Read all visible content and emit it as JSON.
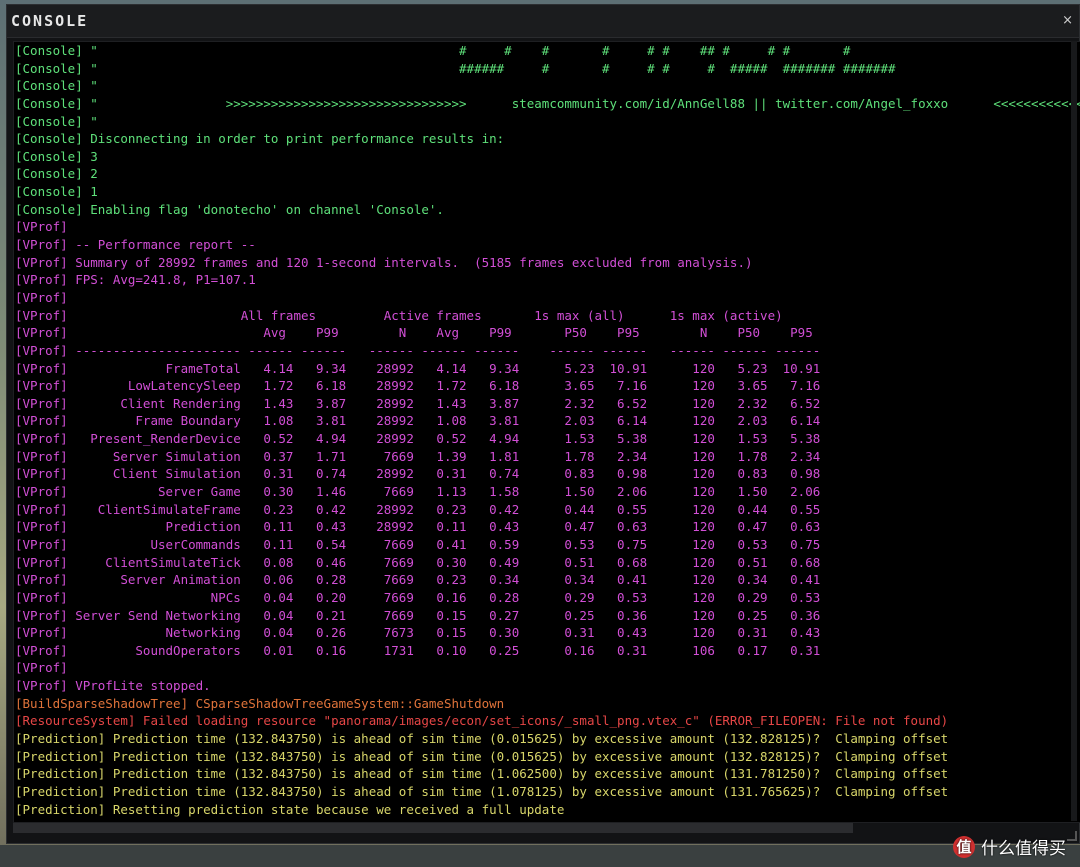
{
  "window": {
    "title": "CONSOLE",
    "close_glyph": "×"
  },
  "log_lines": [
    {
      "t": "console",
      "text": "[Console] \"                                                #     #    #       #     # #    ## #     # #       #"
    },
    {
      "t": "console",
      "text": "[Console] \"                                                ######     #       #     # #     #  #####  ####### #######"
    },
    {
      "t": "console",
      "text": "[Console] \""
    },
    {
      "t": "console",
      "text": "[Console] \"                 >>>>>>>>>>>>>>>>>>>>>>>>>>>>>>>>      steamcommunity.com/id/AnnGell88 || twitter.com/Angel_foxxo      <<<<<<<<<<<<<<<<<<<<<<<<<<<<<<<<"
    },
    {
      "t": "console",
      "text": "[Console] \""
    },
    {
      "t": "console",
      "text": "[Console] Disconnecting in order to print performance results in:"
    },
    {
      "t": "console",
      "text": "[Console] 3"
    },
    {
      "t": "console",
      "text": "[Console] 2"
    },
    {
      "t": "console",
      "text": "[Console] 1"
    },
    {
      "t": "console",
      "text": "[Console] Enabling flag 'donotecho' on channel 'Console'."
    },
    {
      "t": "vprof",
      "text": "[VProf]"
    },
    {
      "t": "vprof",
      "text": "[VProf] -- Performance report --"
    },
    {
      "t": "vprof",
      "text": "[VProf] Summary of 28992 frames and 120 1-second intervals.  (5185 frames excluded from analysis.)"
    },
    {
      "t": "vprof",
      "text": "[VProf] FPS: Avg=241.8, P1=107.1"
    },
    {
      "t": "vprof",
      "text": "[VProf]"
    },
    {
      "t": "vprof",
      "text": "[VProf]                       All frames         Active frames       1s max (all)      1s max (active)"
    },
    {
      "t": "vprof",
      "text": "[VProf]                          Avg    P99        N    Avg    P99       P50    P95        N    P50    P95"
    },
    {
      "t": "vprof",
      "text": "[VProf] ---------------------- ------ ------   ------ ------ ------    ------ ------   ------ ------ ------"
    },
    {
      "t": "vprof",
      "text": "[VProf]             FrameTotal   4.14   9.34    28992   4.14   9.34      5.23  10.91      120   5.23  10.91"
    },
    {
      "t": "vprof",
      "text": "[VProf]        LowLatencySleep   1.72   6.18    28992   1.72   6.18      3.65   7.16      120   3.65   7.16"
    },
    {
      "t": "vprof",
      "text": "[VProf]       Client Rendering   1.43   3.87    28992   1.43   3.87      2.32   6.52      120   2.32   6.52"
    },
    {
      "t": "vprof",
      "text": "[VProf]         Frame Boundary   1.08   3.81    28992   1.08   3.81      2.03   6.14      120   2.03   6.14"
    },
    {
      "t": "vprof",
      "text": "[VProf]   Present_RenderDevice   0.52   4.94    28992   0.52   4.94      1.53   5.38      120   1.53   5.38"
    },
    {
      "t": "vprof",
      "text": "[VProf]      Server Simulation   0.37   1.71     7669   1.39   1.81      1.78   2.34      120   1.78   2.34"
    },
    {
      "t": "vprof",
      "text": "[VProf]      Client Simulation   0.31   0.74    28992   0.31   0.74      0.83   0.98      120   0.83   0.98"
    },
    {
      "t": "vprof",
      "text": "[VProf]            Server Game   0.30   1.46     7669   1.13   1.58      1.50   2.06      120   1.50   2.06"
    },
    {
      "t": "vprof",
      "text": "[VProf]    ClientSimulateFrame   0.23   0.42    28992   0.23   0.42      0.44   0.55      120   0.44   0.55"
    },
    {
      "t": "vprof",
      "text": "[VProf]             Prediction   0.11   0.43    28992   0.11   0.43      0.47   0.63      120   0.47   0.63"
    },
    {
      "t": "vprof",
      "text": "[VProf]           UserCommands   0.11   0.54     7669   0.41   0.59      0.53   0.75      120   0.53   0.75"
    },
    {
      "t": "vprof",
      "text": "[VProf]     ClientSimulateTick   0.08   0.46     7669   0.30   0.49      0.51   0.68      120   0.51   0.68"
    },
    {
      "t": "vprof",
      "text": "[VProf]       Server Animation   0.06   0.28     7669   0.23   0.34      0.34   0.41      120   0.34   0.41"
    },
    {
      "t": "vprof",
      "text": "[VProf]                   NPCs   0.04   0.20     7669   0.16   0.28      0.29   0.53      120   0.29   0.53"
    },
    {
      "t": "vprof",
      "text": "[VProf] Server Send Networking   0.04   0.21     7669   0.15   0.27      0.25   0.36      120   0.25   0.36"
    },
    {
      "t": "vprof",
      "text": "[VProf]             Networking   0.04   0.26     7673   0.15   0.30      0.31   0.43      120   0.31   0.43"
    },
    {
      "t": "vprof",
      "text": "[VProf]         SoundOperators   0.01   0.16     1731   0.10   0.25      0.16   0.31      106   0.17   0.31"
    },
    {
      "t": "vprof",
      "text": "[VProf]"
    },
    {
      "t": "vprof",
      "text": "[VProf] VProfLite stopped."
    },
    {
      "t": "build",
      "text": "[BuildSparseShadowTree] CSparseShadowTreeGameSystem::GameShutdown"
    },
    {
      "t": "res",
      "text": "[ResourceSystem] Failed loading resource \"panorama/images/econ/set_icons/_small_png.vtex_c\" (ERROR_FILEOPEN: File not found)"
    },
    {
      "t": "pred",
      "text": "[Prediction] Prediction time (132.843750) is ahead of sim time (0.015625) by excessive amount (132.828125)?  Clamping offset"
    },
    {
      "t": "pred",
      "text": "[Prediction] Prediction time (132.843750) is ahead of sim time (0.015625) by excessive amount (132.828125)?  Clamping offset"
    },
    {
      "t": "pred",
      "text": "[Prediction] Prediction time (132.843750) is ahead of sim time (1.062500) by excessive amount (131.781250)?  Clamping offset"
    },
    {
      "t": "pred",
      "text": "[Prediction] Prediction time (132.843750) is ahead of sim time (1.078125) by excessive amount (131.765625)?  Clamping offset"
    },
    {
      "t": "pred",
      "text": "[Prediction] Resetting prediction state because we received a full update"
    }
  ],
  "watermark": {
    "logo_glyph": "值",
    "text": "什么值得买"
  },
  "colors": {
    "console": "#5ee07a",
    "vprof": "#d24fd6",
    "build": "#e0733a",
    "res": "#e64646",
    "pred": "#d8d66a"
  }
}
